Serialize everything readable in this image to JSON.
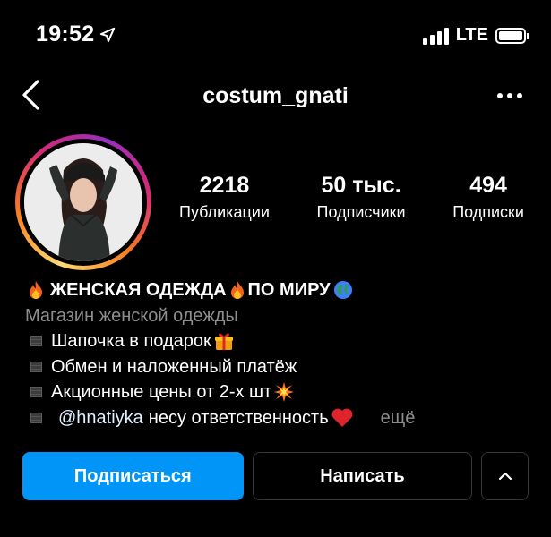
{
  "status_bar": {
    "time": "19:52",
    "network": "LTE",
    "icons": [
      "location-arrow-icon",
      "signal-bars-icon",
      "battery-icon"
    ]
  },
  "nav": {
    "title": "costum_gnati",
    "icons": [
      "back-chevron-icon",
      "more-dots-icon"
    ]
  },
  "profile": {
    "stats": [
      {
        "value": "2218",
        "label": "Публикации"
      },
      {
        "value": "50 тыс.",
        "label": "Подписчики"
      },
      {
        "value": "494",
        "label": "Подписки"
      }
    ]
  },
  "bio": {
    "name_part1": "ЖЕНСКАЯ ОДЕЖДА",
    "name_part2": "ПО МИРУ",
    "category": "Магазин женской одежды",
    "line1": "Шапочка в подарок",
    "line2": "Обмен и наложенный платёж",
    "line3": "Акционные цены от 2-х шт",
    "mention": "@hnatiyka",
    "line4": "несу ответственность",
    "more": "ещё",
    "emoji_icons": [
      "fire-icon",
      "globe-icon",
      "gift-icon",
      "collision-icon",
      "heart-icon"
    ]
  },
  "actions": {
    "follow_label": "Подписаться",
    "message_label": "Написать",
    "expand_icon": "chevron-up-icon"
  },
  "colors": {
    "background": "#000000",
    "primary_button": "#0095f6",
    "secondary_text": "#8e8e8e",
    "heart": "#e0242b"
  }
}
